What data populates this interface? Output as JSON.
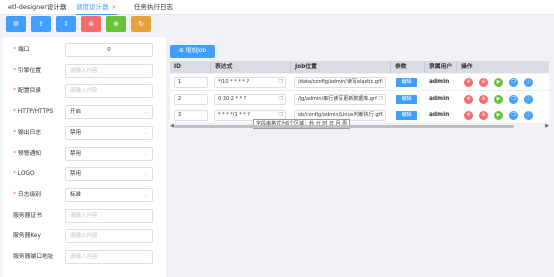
{
  "tabs": [
    {
      "label": "etl-designer设计器"
    },
    {
      "label": "调度设计器",
      "closable": true
    },
    {
      "label": "任务执行日志"
    }
  ],
  "toolbar": {
    "buttons": [
      {
        "name": "settings",
        "icon": "⚙",
        "color": "#409eff"
      },
      {
        "name": "upload",
        "icon": "⇪",
        "color": "#409eff"
      },
      {
        "name": "download",
        "icon": "⇩",
        "color": "#409eff"
      },
      {
        "name": "close",
        "icon": "⊗",
        "color": "#f56c6c"
      },
      {
        "name": "add",
        "icon": "⊕",
        "color": "#67c23a"
      },
      {
        "name": "refresh",
        "icon": "↻",
        "color": "#e6a23c"
      }
    ]
  },
  "form": {
    "fields": [
      {
        "label": "端口",
        "required": true,
        "value": "0",
        "placeholder": "",
        "type": "number"
      },
      {
        "label": "引擎位置",
        "required": true,
        "value": "",
        "placeholder": "请输入内容",
        "type": "text"
      },
      {
        "label": "配置目录",
        "required": true,
        "value": "",
        "placeholder": "请输入内容",
        "type": "text"
      },
      {
        "label": "HTTP/HTTPS",
        "required": true,
        "value": "开启",
        "placeholder": "",
        "type": "select"
      },
      {
        "label": "输出日志",
        "required": true,
        "value": "禁用",
        "placeholder": "",
        "type": "select"
      },
      {
        "label": "预警通知",
        "required": true,
        "value": "禁用",
        "placeholder": "",
        "type": "select"
      },
      {
        "label": "LOGO",
        "required": true,
        "value": "禁用",
        "placeholder": "",
        "type": "select"
      },
      {
        "label": "日志级别",
        "required": true,
        "value": "标准",
        "placeholder": "",
        "type": "select"
      },
      {
        "label": "服务器证书",
        "required": false,
        "value": "",
        "placeholder": "请输入内容",
        "type": "text"
      },
      {
        "label": "服务器Key",
        "required": false,
        "value": "",
        "placeholder": "请输入内容",
        "type": "text"
      },
      {
        "label": "服务器端口地址",
        "required": false,
        "value": "",
        "placeholder": "请输入内容",
        "type": "text"
      }
    ]
  },
  "jobs": {
    "add_label": "增加Job",
    "add_icon": "⊕",
    "columns": [
      "ID",
      "表达式",
      "Job位置",
      "参数",
      "隶属用户",
      "操作"
    ],
    "rows": [
      {
        "id": "1",
        "expr": "*/10 * * * * ?",
        "path": "/data/config/admin/读写elastic.grf",
        "param": "编辑",
        "owner": "admin"
      },
      {
        "id": "2",
        "expr": "0 30 2 * * ?",
        "path": "/lg/admin/串行读写更新数据库.grf",
        "param": "编辑",
        "owner": "admin"
      },
      {
        "id": "3",
        "expr": "* * * */1 * * ?",
        "path": "ob/config/admin/Linux判断执行.grf",
        "param": "编辑",
        "owner": "admin"
      }
    ],
    "actions": [
      {
        "name": "delete",
        "icon": "⊗",
        "color": "#f56c6c"
      },
      {
        "name": "stop",
        "icon": "⊘",
        "color": "#f56c6c"
      },
      {
        "name": "start",
        "icon": "▶",
        "color": "#67c23a"
      },
      {
        "name": "copy",
        "icon": "❐",
        "color": "#409eff"
      },
      {
        "name": "info",
        "icon": "ⓘ",
        "color": "#409eff"
      }
    ],
    "tooltip": "字段串格式为6个区域：秒 分 时 日 月 周"
  }
}
